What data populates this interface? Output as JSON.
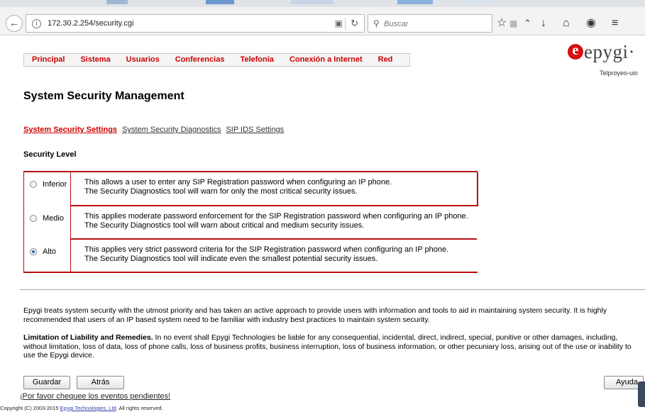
{
  "browser": {
    "url": "172.30.2.254/security.cgi",
    "search_placeholder": "Buscar"
  },
  "nav": {
    "items": [
      "Principal",
      "Sistema",
      "Usuarios",
      "Conferencias",
      "Telefonía",
      "Conexión a Internet",
      "Red"
    ]
  },
  "logo": {
    "mark": "e",
    "name": "epygi",
    "tm": "·",
    "subtitle": "Telproyeo-uio"
  },
  "page": {
    "title": "System Security Management",
    "tabs": [
      {
        "label": "System Security Settings",
        "active": true
      },
      {
        "label": "System Security Diagnostics",
        "active": false
      },
      {
        "label": "SIP IDS Settings",
        "active": false
      }
    ],
    "section_label": "Security Level",
    "levels": [
      {
        "label": "Inferior",
        "selected": false,
        "line1": "This allows a user to enter any SIP Registration password when configuring an IP phone.",
        "line2": "The Security Diagnostics tool will warn for only the most critical security issues."
      },
      {
        "label": "Medio",
        "selected": false,
        "line1": "This applies moderate password enforcement for the SIP Registration password when configuring an IP phone.",
        "line2": "The Security Diagnostics tool will warn about critical and medium security issues."
      },
      {
        "label": "Alto",
        "selected": true,
        "line1": "This applies very strict password criteria for the SIP Registration password when configuring an IP phone.",
        "line2": "The Security Diagnostics tool will indicate even the smallest potential security issues."
      }
    ],
    "intro_text": "Epygi treats system security with the utmost priority and has taken an active approach to provide users with information and tools to aid in maintaining system security. It is highly recommended that users of an IP based system need to be familiar with industry best practices to maintain system security.",
    "liability_heading": "Limitation of Liability and Remedies.",
    "liability_text": " In no event shall Epygi Technologies be liable for any consequential, incidental, direct, indirect, special, punitive or other damages, including, without limitation, loss of data, loss of phone calls, loss of business profits, business interruption, loss of business information, or other pecuniary loss, arising out of the use or inability to use the Epygi device.",
    "buttons": {
      "save": "Guardar",
      "back": "Atrás",
      "help": "Ayuda"
    },
    "pending_events": "¡Por favor chequee los eventos pendientes!",
    "copyright_prefix": "Copyright (C) 2003-2015 ",
    "copyright_link": "Epygi Technologies, Ltd",
    "copyright_suffix": ". All rights reserved."
  },
  "colors": {
    "accent": "#cc0000",
    "border": "#b80e0e"
  }
}
